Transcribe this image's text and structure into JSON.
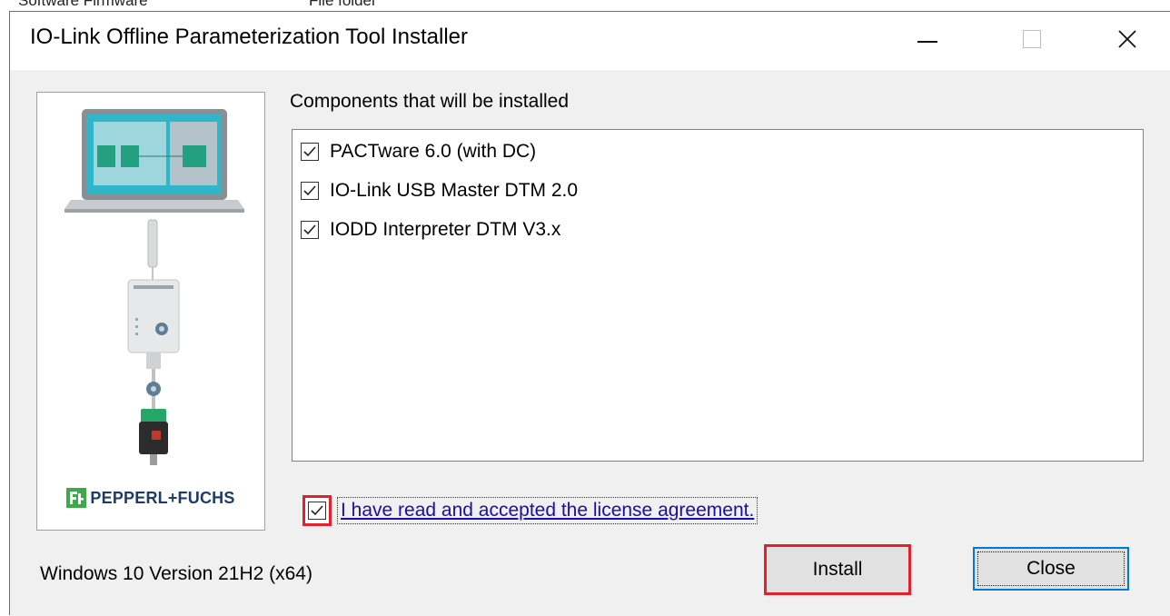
{
  "window": {
    "title": "IO-Link Offline Parameterization Tool Installer",
    "controls": {
      "minimize": "minimize",
      "maximize": "maximize",
      "close": "close"
    }
  },
  "background_fragments": [
    "Software Firmware",
    "File folder"
  ],
  "sidebar": {
    "brand_name": "PEPPERL+FUCHS",
    "brand_color": "#3fa84b",
    "illustration": [
      "laptop-screen-diagram",
      "usb-cable",
      "io-link-usb-master",
      "sensor"
    ]
  },
  "components": {
    "heading": "Components that will be installed",
    "items": [
      {
        "label": "PACTware 6.0 (with DC)",
        "checked": true
      },
      {
        "label": "IO-Link USB Master DTM 2.0",
        "checked": true
      },
      {
        "label": "IODD Interpreter DTM V3.x",
        "checked": true
      }
    ]
  },
  "license": {
    "label": "I have read and accepted the license agreement.",
    "checked": true
  },
  "status": {
    "os_version": "Windows 10 Version 21H2 (x64)"
  },
  "buttons": {
    "install": "Install",
    "close": "Close"
  },
  "colors": {
    "highlight": "#e5202e",
    "link": "#1a0dab",
    "focus_border": "#0078d7",
    "dialog_bg": "#f0f0f0"
  }
}
